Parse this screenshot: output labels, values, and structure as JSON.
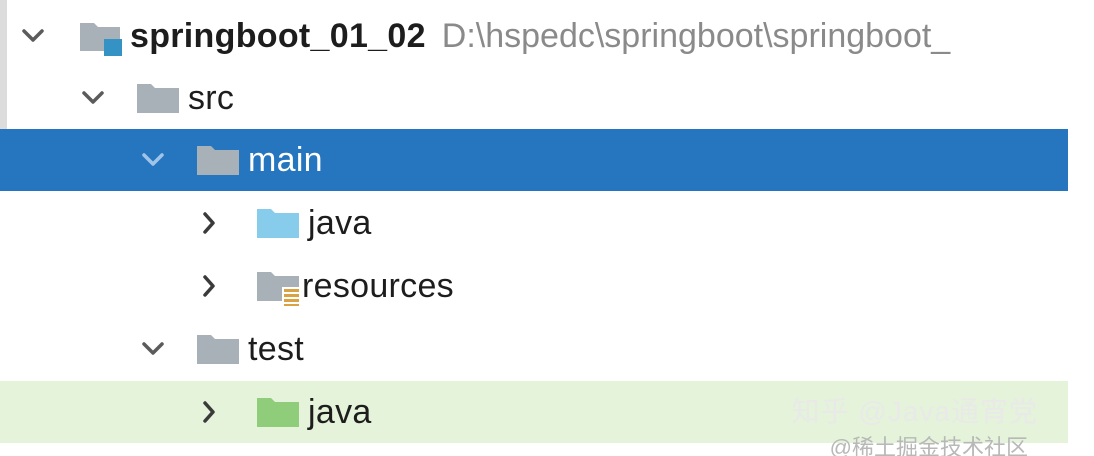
{
  "tree": {
    "project": {
      "name": "springboot_01_02",
      "path": "D:\\hspedc\\springboot\\springboot_"
    },
    "nodes": [
      {
        "label": "src",
        "icon": "folder-icon",
        "expanded": true
      },
      {
        "label": "main",
        "icon": "folder-icon",
        "expanded": true,
        "selected": true
      },
      {
        "label": "java",
        "icon": "source-folder-icon",
        "expanded": false
      },
      {
        "label": "resources",
        "icon": "resources-folder-icon",
        "expanded": false
      },
      {
        "label": "test",
        "icon": "folder-icon",
        "expanded": true
      },
      {
        "label": "java",
        "icon": "test-folder-icon",
        "expanded": false,
        "highlighted": true
      }
    ]
  },
  "watermark": {
    "primary": "知乎 @Java通宵党",
    "secondary": "@稀土掘金技术社区"
  },
  "colors": {
    "selection": "#2675bf",
    "highlight": "#e4f3d9",
    "source_folder": "#88ccec",
    "test_folder": "#8fcd7a",
    "plain_folder": "#a9b1b8",
    "module_badge": "#3592c4",
    "resources_badge": "#d9a343"
  }
}
